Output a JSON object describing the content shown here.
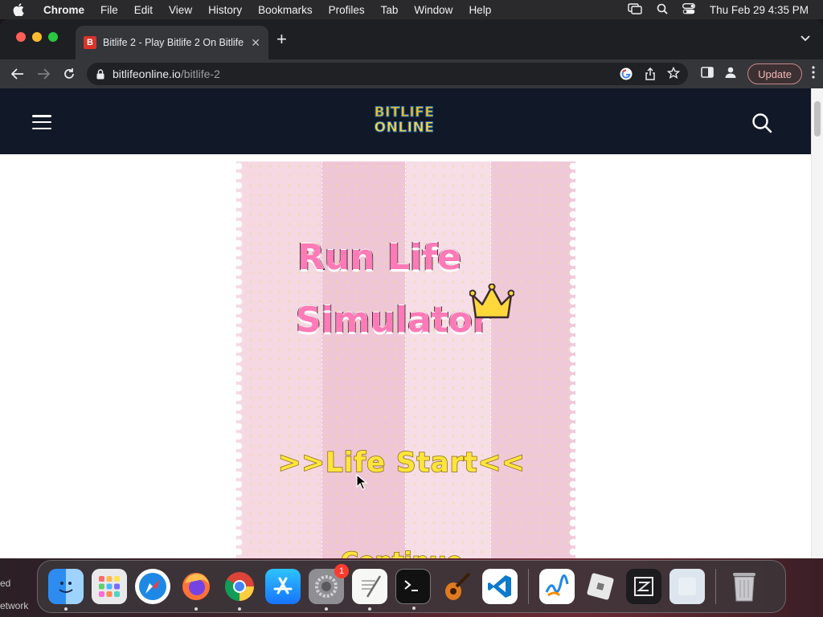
{
  "menubar": {
    "app_name": "Chrome",
    "items": [
      "File",
      "Edit",
      "View",
      "History",
      "Bookmarks",
      "Profiles",
      "Tab",
      "Window",
      "Help"
    ],
    "datetime": "Thu Feb 29  4:35 PM"
  },
  "browser": {
    "tab_title": "Bitlife 2 - Play Bitlife 2 On Bitlife",
    "tab_favicon_letter": "B",
    "url_domain": "bitlifeonline.io",
    "url_path": "/bitlife-2",
    "update_label": "Update"
  },
  "site": {
    "logo_line1": "BITLIFE",
    "logo_line2": "ONLINE"
  },
  "game": {
    "title_line1": "Run Life",
    "title_line2": "Simulator",
    "start_label": ">>Life Start<<",
    "continue_label": "Continue"
  },
  "desktop": {
    "fragment_1": "ed",
    "fragment_2": "etwork"
  },
  "dock": {
    "items": [
      "finder-icon",
      "launchpad-icon",
      "safari-icon",
      "firefox-icon",
      "chrome-icon",
      "app-store-icon",
      "system-settings-icon",
      "textedit-icon",
      "terminal-icon",
      "garageband-icon",
      "vscode-icon",
      "freeform-icon",
      "roblox-icon",
      "zed-icon",
      "preview-icon",
      "trash-icon"
    ],
    "settings_badge": "1"
  }
}
